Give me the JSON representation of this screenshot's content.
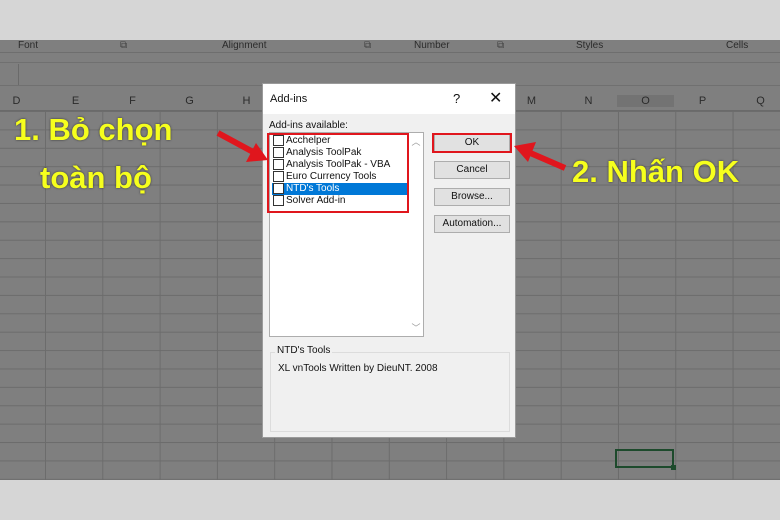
{
  "ribbon": {
    "groups": [
      "Font",
      "Alignment",
      "Number",
      "Styles",
      "Cells"
    ]
  },
  "columns": [
    "D",
    "E",
    "F",
    "G",
    "H",
    "M",
    "N",
    "O",
    "P",
    "Q"
  ],
  "dialog": {
    "title": "Add-ins",
    "help": "?",
    "close": "✕",
    "list_label": "Add-ins available:",
    "items": [
      {
        "label": "Acchelper",
        "checked": false,
        "selected": false
      },
      {
        "label": "Analysis ToolPak",
        "checked": false,
        "selected": false
      },
      {
        "label": "Analysis ToolPak - VBA",
        "checked": false,
        "selected": false
      },
      {
        "label": "Euro Currency Tools",
        "checked": false,
        "selected": false
      },
      {
        "label": "NTD's Tools",
        "checked": false,
        "selected": true
      },
      {
        "label": "Solver Add-in",
        "checked": false,
        "selected": false
      }
    ],
    "buttons": {
      "ok": "OK",
      "cancel": "Cancel",
      "browse": "Browse...",
      "automation": "Automation..."
    },
    "desc_title": "NTD's Tools",
    "desc_text": "XL vnTools Written by DieuNT. 2008"
  },
  "annotations": {
    "step1_line1": "1. Bỏ chọn",
    "step1_line2": "toàn bộ",
    "step2": "2. Nhấn OK",
    "text_color": "#f6ff1d",
    "highlight_color": "#e0161d"
  }
}
